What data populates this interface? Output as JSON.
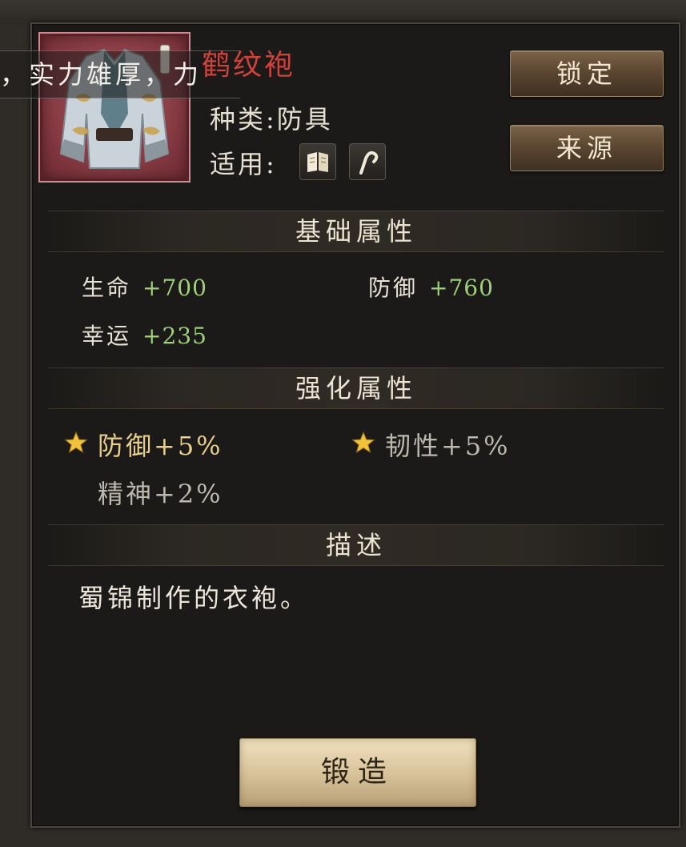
{
  "ticker": {
    "text": "，实力雄厚，力"
  },
  "item": {
    "name": "鹤纹袍",
    "category": "种类:防具",
    "applicable_label": "适用:",
    "applicable_icons": [
      "book-icon",
      "hook-icon"
    ],
    "name_color": "#d2413a",
    "frame_color": "#8a3c45"
  },
  "buttons": {
    "lock": "锁定",
    "source": "来源",
    "forge": "锻造"
  },
  "basic": {
    "title": "基础属性",
    "stats": [
      {
        "label": "生命",
        "value": "+700"
      },
      {
        "label": "防御",
        "value": "+760"
      },
      {
        "label": "幸运",
        "value": "+235"
      }
    ]
  },
  "enhanced": {
    "title": "强化属性",
    "stats": [
      {
        "text": "防御+5%",
        "starred": true
      },
      {
        "text": "韧性+5%",
        "starred": true
      },
      {
        "text": "精神+2%",
        "starred": false
      }
    ]
  },
  "description": {
    "title": "描述",
    "text": "蜀锦制作的衣袍。"
  },
  "colors": {
    "value_green": "#9fd07a",
    "enhanced_gold": "#e9cf8a",
    "star_gold": "#f2c23a"
  }
}
